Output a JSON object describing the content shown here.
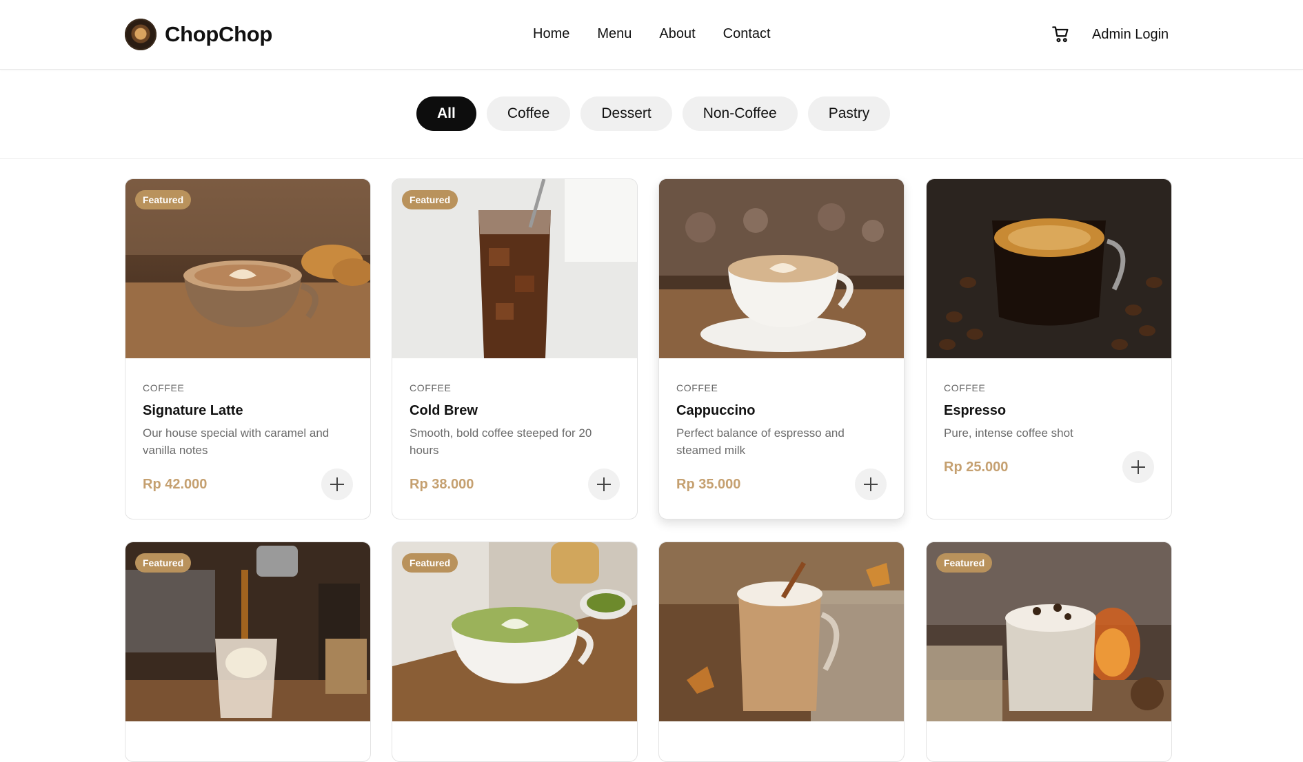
{
  "brand": {
    "name": "ChopChop"
  },
  "nav": [
    "Home",
    "Menu",
    "About",
    "Contact"
  ],
  "header": {
    "admin_label": "Admin Login"
  },
  "filters": {
    "active": "All",
    "items": [
      "All",
      "Coffee",
      "Dessert",
      "Non-Coffee",
      "Pastry"
    ]
  },
  "colors": {
    "accent": "#c5a070",
    "badge": "#b9925c",
    "active_chip": "#0d0d0d"
  },
  "products": [
    {
      "badge": "Featured",
      "category": "COFFEE",
      "name": "Signature Latte",
      "description": "Our house special with caramel and vanilla notes",
      "price": "Rp 42.000"
    },
    {
      "badge": "Featured",
      "category": "COFFEE",
      "name": "Cold Brew",
      "description": "Smooth, bold coffee steeped for 20 hours",
      "price": "Rp 38.000"
    },
    {
      "badge": "",
      "category": "COFFEE",
      "name": "Cappuccino",
      "description": "Perfect balance of espresso and steamed milk",
      "price": "Rp 35.000"
    },
    {
      "badge": "",
      "category": "COFFEE",
      "name": "Espresso",
      "description": "Pure, intense coffee shot",
      "price": "Rp 25.000"
    },
    {
      "badge": "Featured"
    },
    {
      "badge": "Featured"
    },
    {
      "badge": ""
    },
    {
      "badge": "Featured"
    }
  ]
}
